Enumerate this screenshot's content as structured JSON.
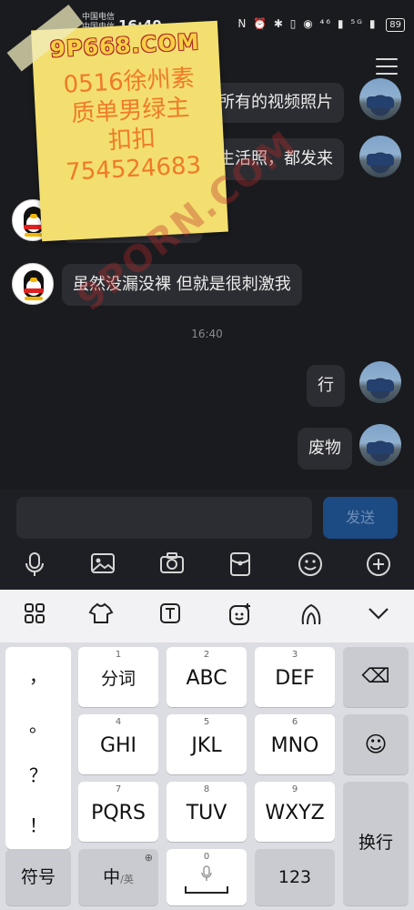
{
  "status_bar": {
    "carrier_1": "中国电信",
    "carrier_2": "中国电信",
    "time": "16:40",
    "icons": "N ⏰ ✱ ▯ ◉ ⁴⁶ ▮ ⁵ᴳ ▮",
    "battery": "89"
  },
  "sticker": {
    "site": "9P668.COM",
    "lines": [
      "0516徐州素",
      "质单男绿主",
      "扣扣",
      "754524683"
    ]
  },
  "watermark": "9PORN.COM",
  "chat": {
    "messages": [
      {
        "side": "right",
        "text": "所有的视频照片",
        "avatar": "car-avatar"
      },
      {
        "side": "right",
        "text": "生活照，都发来",
        "avatar": "car-avatar"
      },
      {
        "side": "left",
        "text": "",
        "avatar": "qq-avatar"
      },
      {
        "side": "left",
        "text": "虽然没漏没裸 但就是很刺激我",
        "avatar": "qq-avatar"
      },
      {
        "side": "right",
        "text": "行",
        "avatar": "car-avatar"
      },
      {
        "side": "right",
        "text": "废物",
        "avatar": "car-avatar"
      }
    ],
    "timestamp": "16:40"
  },
  "input": {
    "placeholder": "",
    "send_label": "发送",
    "tools": [
      "microphone-icon",
      "image-icon",
      "camera-icon",
      "red-packet-icon",
      "emoji-icon",
      "plus-icon"
    ]
  },
  "keyboard": {
    "toolbar": [
      "grid-icon",
      "skin-icon",
      "text-icon",
      "sticker-icon",
      "handwrite-icon",
      "collapse-icon"
    ],
    "punctuation": [
      "，",
      "。",
      "？",
      "！"
    ],
    "keys": [
      {
        "num": "1",
        "label": "分词"
      },
      {
        "num": "2",
        "label": "ABC"
      },
      {
        "num": "3",
        "label": "DEF"
      },
      {
        "num": "4",
        "label": "GHI"
      },
      {
        "num": "5",
        "label": "JKL"
      },
      {
        "num": "6",
        "label": "MNO"
      },
      {
        "num": "7",
        "label": "PQRS"
      },
      {
        "num": "8",
        "label": "TUV"
      },
      {
        "num": "9",
        "label": "WXYZ"
      }
    ],
    "delete_icon": "⌫",
    "emoji_icon": "☺",
    "enter_label": "换行",
    "symbol_label": "符号",
    "lang_label_main": "中",
    "lang_label_sub": "/英",
    "globe_icon": "⊕",
    "space_num": "0",
    "mic_glyph": "🎙",
    "num_label": "123"
  }
}
